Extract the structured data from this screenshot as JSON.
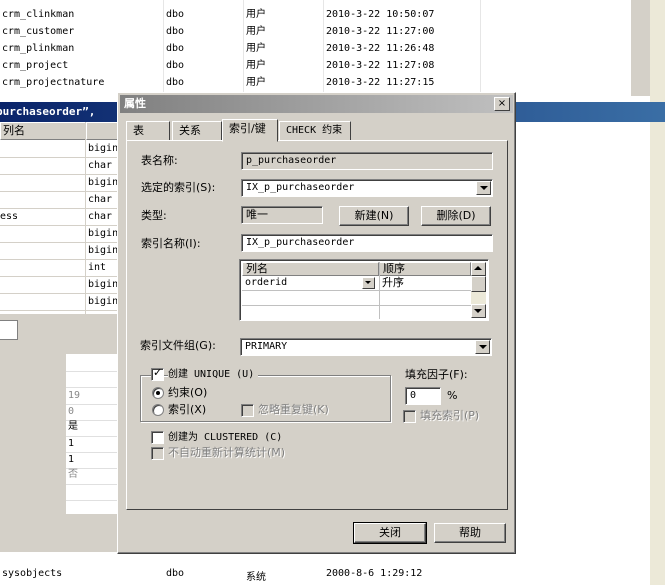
{
  "background": {
    "objects": [
      {
        "name": "crm_clinkman",
        "owner": "dbo",
        "type": "用户",
        "created": "2010-3-22 10:50:07"
      },
      {
        "name": "crm_customer",
        "owner": "dbo",
        "type": "用户",
        "created": "2010-3-22 11:27:00"
      },
      {
        "name": "crm_plinkman",
        "owner": "dbo",
        "type": "用户",
        "created": "2010-3-22 11:26:48"
      },
      {
        "name": "crm_project",
        "owner": "dbo",
        "type": "用户",
        "created": "2010-3-22 11:27:08"
      },
      {
        "name": "crm_projectnature",
        "owner": "dbo",
        "type": "用户",
        "created": "2010-3-22 11:27:15"
      }
    ],
    "design_window_title": "purchaseorder”, ",
    "design_grid": {
      "col_header": "列名",
      "rows": [
        {
          "name": "",
          "type": "bigin"
        },
        {
          "name": "",
          "type": "char"
        },
        {
          "name": "",
          "type": "bigin"
        },
        {
          "name": "",
          "type": "char"
        },
        {
          "name": "ess",
          "type": "char"
        },
        {
          "name": "",
          "type": "bigin"
        },
        {
          "name": "",
          "type": "bigin"
        },
        {
          "name": "",
          "type": "int"
        },
        {
          "name": "",
          "type": "bigin"
        },
        {
          "name": "",
          "type": "bigin"
        }
      ]
    },
    "column_props": [
      "19",
      "0",
      "是",
      "1",
      "1",
      "否"
    ],
    "bottom_object": {
      "name": "sysobjects",
      "owner": "dbo",
      "type": "系统",
      "created": "2000-8-6 1:29:12"
    }
  },
  "dialog": {
    "title": "属性",
    "close_glyph": "×",
    "tabs": [
      "表",
      "关系",
      "索引/键",
      "CHECK 约束"
    ],
    "active_tab": 2,
    "table_name_label": "表名称:",
    "table_name_value": "p_purchaseorder",
    "selected_index_label": "选定的索引(S):",
    "selected_index_value": "IX_p_purchaseorder",
    "type_label": "类型:",
    "type_value": "唯一",
    "new_button": "新建(N)",
    "delete_button": "删除(D)",
    "index_name_label": "索引名称(I):",
    "index_name_value": "IX_p_purchaseorder",
    "index_columns": {
      "headers": [
        "列名",
        "顺序"
      ],
      "rows": [
        {
          "column": "orderid",
          "order": "升序"
        }
      ]
    },
    "filegroup_label": "索引文件组(G):",
    "filegroup_value": "PRIMARY",
    "create_unique_label": "创建 UNIQUE (U)",
    "create_unique_checked": true,
    "constraint_label": "约束(O)",
    "index_label": "索引(X)",
    "ignore_dup_label": "忽略重复键(K)",
    "fill_factor_label": "填充因子(F):",
    "fill_factor_value": "0",
    "fill_factor_unit": "%",
    "pad_index_label": "填充索引(P)",
    "clustered_label": "创建为 CLUSTERED (C)",
    "no_recompute_label": "不自动重新计算统计(M)",
    "close_button": "关闭",
    "help_button": "帮助"
  }
}
